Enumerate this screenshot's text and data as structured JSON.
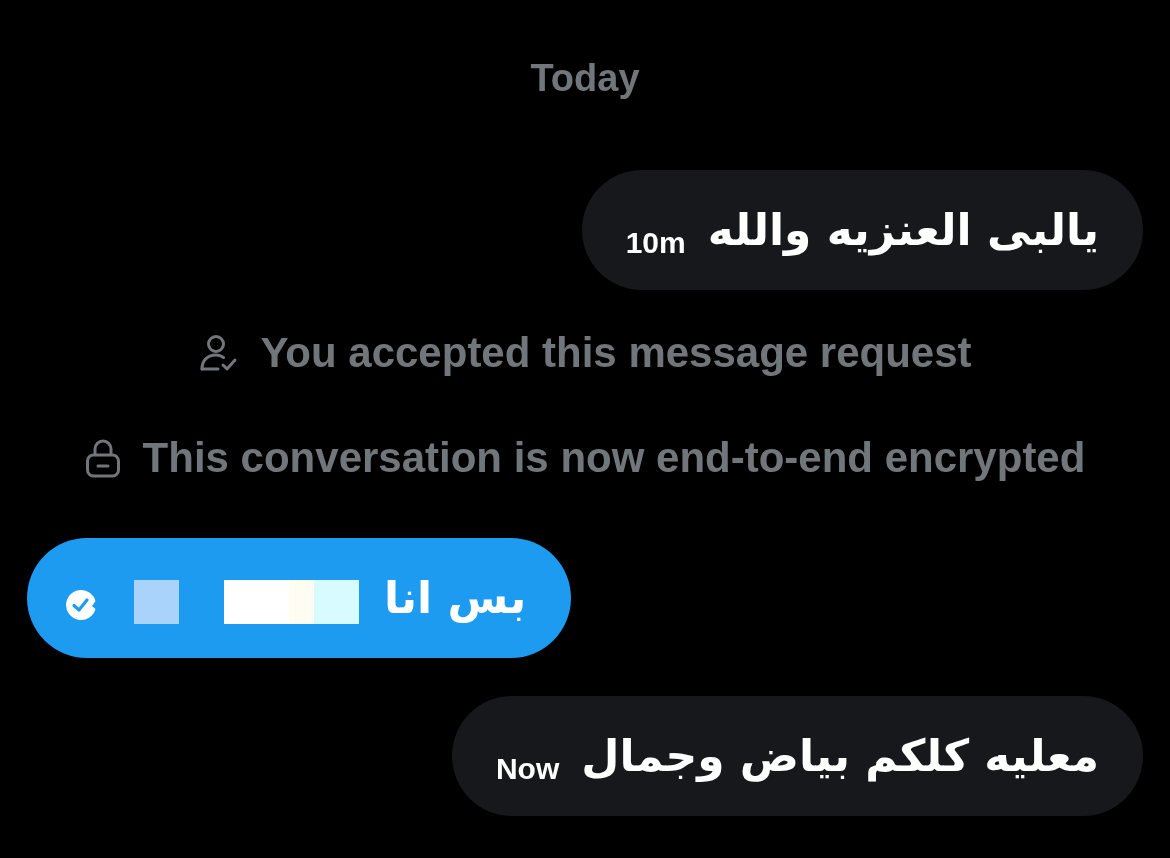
{
  "date_divider": "Today",
  "messages": [
    {
      "kind": "received",
      "text": "يالبى العنزيه والله",
      "time": "10m"
    },
    {
      "kind": "accepted",
      "text": "You accepted this message request"
    },
    {
      "kind": "encrypted",
      "text": "This conversation is now end-to-end encrypted"
    },
    {
      "kind": "sent",
      "text": "بس انا",
      "seen": true,
      "redacted": true
    },
    {
      "kind": "received",
      "text": "معليه كلكم بياض وجمال",
      "time": "Now"
    }
  ]
}
